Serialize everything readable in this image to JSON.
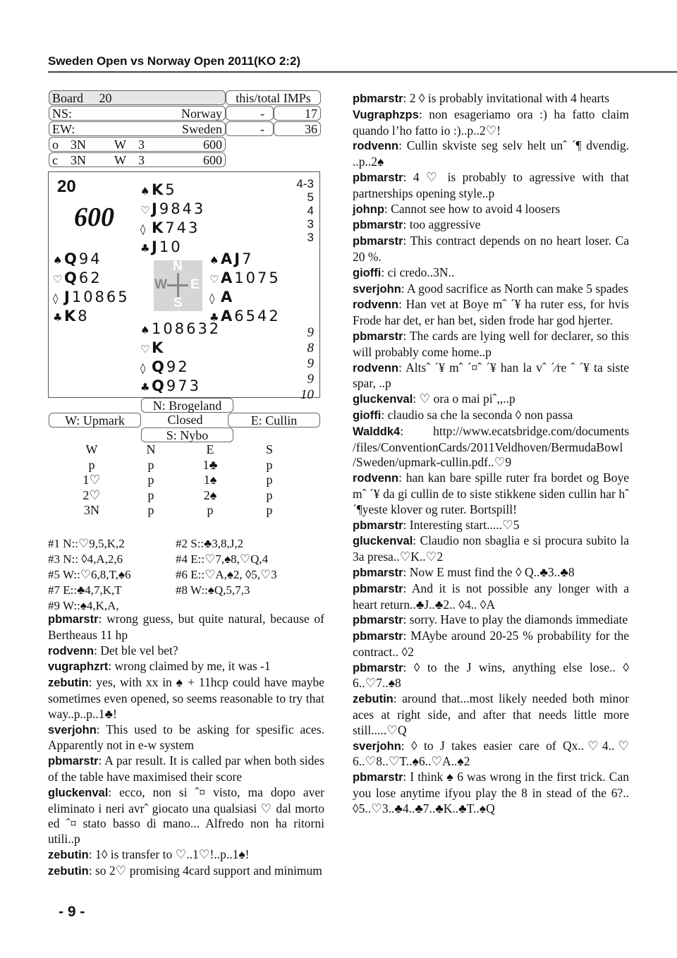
{
  "header": {
    "title": "Sweden Open vs Norway Open 2011(KO 2:2)"
  },
  "score_table": {
    "board_label": "Board",
    "board_number": "20",
    "imps_header": "this/total IMPs",
    "ns_label": "NS:",
    "ns_team": "Norway",
    "ns_this": "-",
    "ns_total": "17",
    "ew_label": "EW:",
    "ew_team": "Sweden",
    "ew_this": "-",
    "ew_total": "36",
    "open_room": {
      "room": "o",
      "contract": "3N",
      "declarer": "W",
      "tricks": "3",
      "score": "600"
    },
    "closed_room": {
      "room": "c",
      "contract": "3N",
      "declarer": "W",
      "tricks": "3",
      "score": "600"
    }
  },
  "deal": {
    "board_number": "20",
    "score": "600",
    "hcp": [
      "4-3",
      "5",
      "4",
      "3",
      "3"
    ],
    "tricks": [
      "9",
      "8",
      "9",
      "9",
      "10"
    ],
    "compass": {
      "n": "N",
      "e": "E",
      "s": "S",
      "w": "W"
    },
    "north": {
      "spades": [
        "K",
        "5"
      ],
      "hearts": [
        "J",
        "9843"
      ],
      "diamonds": [
        "K",
        "743"
      ],
      "clubs": [
        "J",
        "10"
      ]
    },
    "west": {
      "spades": [
        "Q",
        "94"
      ],
      "hearts": [
        "Q",
        "62"
      ],
      "diamonds": [
        "J",
        "10865"
      ],
      "clubs": [
        "K",
        "8"
      ]
    },
    "east": {
      "spades": [
        "AJ",
        "7"
      ],
      "hearts": [
        "A",
        "1075"
      ],
      "diamonds": [
        "A",
        ""
      ],
      "clubs": [
        "A",
        "6542"
      ]
    },
    "south": {
      "spades": [
        "",
        "108632"
      ],
      "hearts": [
        "K",
        ""
      ],
      "diamonds": [
        "Q",
        "92"
      ],
      "clubs": [
        "Q",
        "973"
      ]
    }
  },
  "players": {
    "north": "N: Brogeland",
    "west": "W: Upmark",
    "room": "Closed",
    "east": "E: Cullin",
    "south": "S: Nybo"
  },
  "bidding": {
    "headers": [
      "W",
      "N",
      "E",
      "S"
    ],
    "rows": [
      [
        "p",
        "p",
        "1♣",
        "p"
      ],
      [
        "1♡",
        "p",
        "1♠",
        "p"
      ],
      [
        "2♡",
        "p",
        "2♠",
        "p"
      ],
      [
        "3N",
        "p",
        "p",
        "p"
      ]
    ]
  },
  "play": [
    [
      "#1 N::♡9,5,K,2",
      "#2 S::♣3,8,J,2"
    ],
    [
      "#3 N:: ◊4,A,2,6",
      "#4 E::♡7,♠8,♡Q,4"
    ],
    [
      "#5 W::♡6,8,T,♠6",
      "#6 E::♡A,♠2, ◊5,♡3"
    ],
    [
      "#7 E::♣4,7,K,T",
      "#8 W::♠Q,5,7,3"
    ],
    [
      "#9 W::♠4,K,A,",
      ""
    ]
  ],
  "comments_left": [
    {
      "user": "pbmarstr",
      "text": ": wrong guess, but quite natural, because of Bertheaus 11 hp"
    },
    {
      "user": "rodvenn",
      "text": ":  Det ble vel bet?"
    },
    {
      "user": "vugraphzrt",
      "text": ": wrong claimed by me, it was -1"
    },
    {
      "user": "zebutin",
      "text": ": yes, with xx in ♠ + 11hcp could have maybe sometimes even opened, so seems reasonable to try that way..p..p..1♣!"
    },
    {
      "user": "sverjohn",
      "text": ": This used to be asking for spesific aces. Apparently not in e-w system"
    },
    {
      "user": "pbmarstr",
      "text": ": A par result. It is called par when both sides of the table have maximised their score"
    },
    {
      "user": "gluckenval",
      "text": ": ecco, non si ˆ¤ visto, ma dopo aver eliminato i neri avrˆ  giocato una qualsiasi ♡ dal morto ed ˆ¤ stato basso di mano... Alfredo non ha ritorni utili..p"
    },
    {
      "user": "zebutin",
      "text": ": 1◊ is transfer to ♡..1♡!..p..1♠!"
    },
    {
      "user": "zebutin",
      "text": ": so 2♡ promising 4card support and minimum"
    }
  ],
  "comments_right": [
    {
      "user": "pbmarstr",
      "text": ": 2 ◊ is probably invitational with 4 hearts"
    },
    {
      "user": "Vugraphzps",
      "text": ": non esageriamo ora :) ha fatto claim quando l’ho fatto io :)..p..2♡!"
    },
    {
      "user": "rodvenn",
      "text": ":  Cullin skviste seg selv helt unˆ ´¶ dvendig. ..p..2♠"
    },
    {
      "user": "pbmarstr",
      "text": ": 4 ♡ is probably to agressive with that partnerships opening style..p"
    },
    {
      "user": "johnp",
      "text": ": Cannot see how to avoid 4 loosers"
    },
    {
      "user": "pbmarstr",
      "text": ": too aggressive"
    },
    {
      "user": "pbmarstr",
      "text": ": This contract depends on no heart loser. Ca 20 %."
    },
    {
      "user": "gioffi",
      "text": ": ci credo..3N.."
    },
    {
      "user": "sverjohn",
      "text": ": A good sacrifice as North can make 5 spades"
    },
    {
      "user": "rodvenn",
      "text": ":  Han vet at Boye mˆ ´¥ ha ruter ess, for hvis Frode har det, er han bet, siden frode har god hjerter."
    },
    {
      "user": "pbmarstr",
      "text": ": The cards are lying well for declarer, so this will probably come home..p"
    },
    {
      "user": "rodvenn",
      "text": ":  Altsˆ ´¥ mˆ ´¤ˆ ´¥ han la vˆ ´⁄re ˆ ´¥ ta siste spar, ..p"
    },
    {
      "user": "gluckenval",
      "text": ": ♡ ora o mai piˆ,,..p"
    },
    {
      "user": "gioffi",
      "text": ": claudio sa che la seconda ◊ non passa"
    },
    {
      "user": "Walddk4",
      "text": ": http://www.ecatsbridge.com/documents /files/ConventionCards/2011Veldhoven/BermudaBowl /Sweden/upmark-cullin.pdf..♡9"
    },
    {
      "user": "rodvenn",
      "text": ":  han kan bare spille ruter fra bordet og Boye mˆ ´¥ da gi cullin de to siste stikkene siden cullin har hˆ ´¶yeste klover og ruter. Bortspill!"
    },
    {
      "user": "pbmarstr",
      "text": ": Interesting start.....♡5"
    },
    {
      "user": "gluckenval",
      "text": ": Claudio non sbaglia e si procura subito la 3a presa..♡K..♡2"
    },
    {
      "user": "pbmarstr",
      "text": ": Now E must find the ◊ Q..♣3..♣8"
    },
    {
      "user": "pbmarstr",
      "text": ": And it is not possible any longer with a heart return..♣J..♣2.. ◊4.. ◊A"
    },
    {
      "user": "pbmarstr",
      "text": ": sorry. Have to play the diamonds immediate"
    },
    {
      "user": "pbmarstr",
      "text": ": MAybe around 20-25 % probability for the contract.. ◊2"
    },
    {
      "user": "pbmarstr",
      "text": ":  ◊ to the J wins, anything else lose.. ◊ 6..♡7..♠8"
    },
    {
      "user": "zebutin",
      "text": ": around that...most likely needed both minor aces at right side, and after that needs little more still.....♡Q"
    },
    {
      "user": "sverjohn",
      "text": ": ◊ to J takes easier care of Qx..♡4..♡ 6..♡8..♡T..♠6..♡A..♠2"
    },
    {
      "user": "pbmarstr",
      "text": ": I think ♠ 6 was wrong in the first trick. Can you lose anytime ifyou play the 8 in stead of the 6?.. ◊5..♡3..♣4..♣7..♣K..♣T..♠Q"
    }
  ],
  "icons": {
    "spade": "♠",
    "heart": "♡",
    "diamond": "◊",
    "club": "♣"
  },
  "footer": {
    "page_number": "- 9 -"
  }
}
